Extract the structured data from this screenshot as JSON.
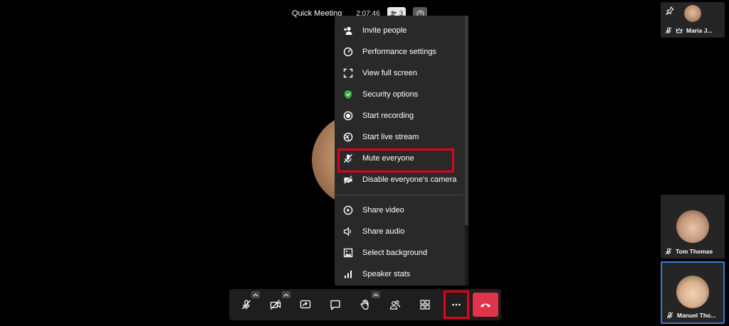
{
  "header": {
    "meeting_title": "Quick Meeting",
    "elapsed_time": "2:07:46",
    "participant_count": "3",
    "participants_icon": "people-icon",
    "info_icon": "info-icon"
  },
  "more_menu": {
    "items_group1": [
      {
        "label": "Invite people",
        "icon": "invite-people-icon"
      },
      {
        "label": "Performance settings",
        "icon": "performance-gauge-icon"
      },
      {
        "label": "View full screen",
        "icon": "fullscreen-icon"
      },
      {
        "label": "Security options",
        "icon": "shield-icon"
      },
      {
        "label": "Start recording",
        "icon": "record-icon"
      },
      {
        "label": "Start live stream",
        "icon": "live-stream-icon"
      },
      {
        "label": "Mute everyone",
        "icon": "mute-everyone-icon",
        "highlighted": true
      },
      {
        "label": "Disable everyone's camera",
        "icon": "camera-off-icon"
      }
    ],
    "items_group2": [
      {
        "label": "Share video",
        "icon": "play-icon"
      },
      {
        "label": "Share audio",
        "icon": "speaker-icon"
      },
      {
        "label": "Select background",
        "icon": "image-icon"
      },
      {
        "label": "Speaker stats",
        "icon": "bar-stats-icon"
      }
    ]
  },
  "toolbar": {
    "buttons": [
      "microphone-muted-icon",
      "camera-off-icon",
      "share-screen-icon",
      "chat-icon",
      "raise-hand-icon",
      "participants-icon",
      "tile-view-icon",
      "more-actions-icon",
      "hangup-icon"
    ]
  },
  "filmstrip": {
    "tiles": [
      {
        "name": "Maria J...",
        "icon": "mic-muted-icon",
        "role_icon": "moderator-crown-icon",
        "pinned_icon": "pin-icon"
      },
      {
        "name": "Tom Thomas",
        "icon": "mic-muted-icon"
      },
      {
        "name": "Manuel Tho...",
        "icon": "mic-muted-icon",
        "active": true
      }
    ]
  },
  "colors": {
    "background": "#000000",
    "menu_background": "#292929",
    "highlight_red": "#e3001b",
    "hangup_red": "#e0344a",
    "active_tile_border": "#3a7bd5",
    "shield_green": "#3fb14a"
  }
}
